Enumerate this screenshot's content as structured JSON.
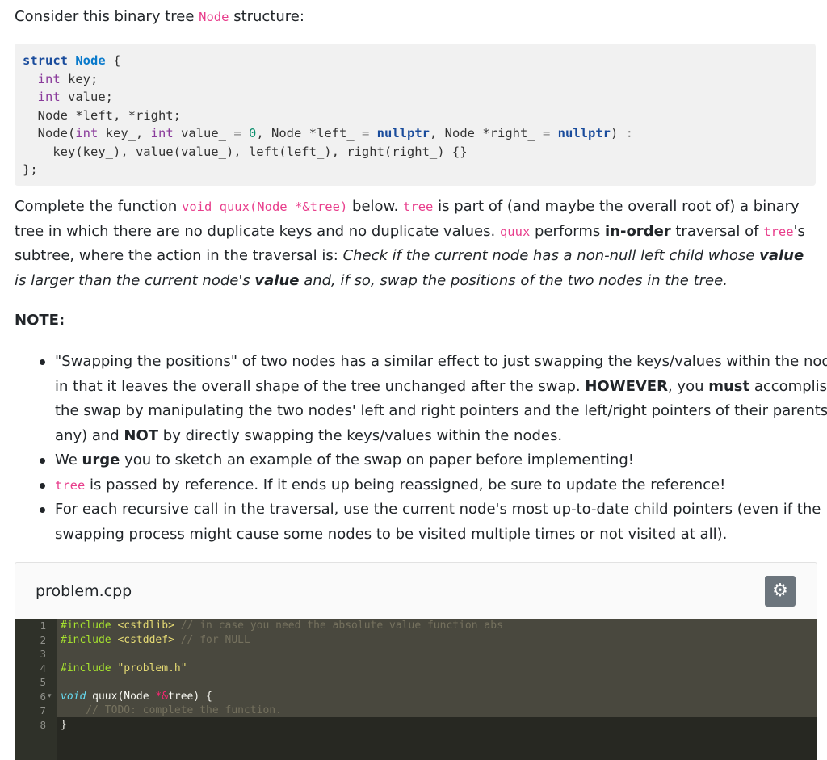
{
  "intro": {
    "before": "Consider this binary tree ",
    "code": "Node",
    "after": " structure:"
  },
  "struct_code": {
    "l1_kw": "struct",
    "l1_name": "Node",
    "l1_rest": " {",
    "l2_type": "int",
    "l2_rest": " key;",
    "l3_type": "int",
    "l3_rest": " value;",
    "l4": "Node *left, *right;",
    "l5_a": "Node(",
    "l5_t1": "int",
    "l5_b": " key_, ",
    "l5_t2": "int",
    "l5_c": " value_ ",
    "l5_eq1": "=",
    "l5_zero": " 0",
    "l5_d": ", Node *left_ ",
    "l5_eq2": "=",
    "l5_null1": " nullptr",
    "l5_e": ", Node *right_ ",
    "l5_eq3": "=",
    "l5_null2": " nullptr",
    "l5_f": ") ",
    "l5_colon": ":",
    "l6": "key(key_), value(value_), left(left_), right(right_) {}",
    "l7": "};"
  },
  "description": {
    "p1": "Complete the function ",
    "c1": "void quux(Node *&tree)",
    "p2": " below. ",
    "c2": "tree",
    "p3": " is part of (and maybe the overall root of) a binary tree in which there are no duplicate keys and no duplicate values. ",
    "c3": "quux",
    "p4": " performs ",
    "b1": "in-order",
    "p5": " traversal of ",
    "c4": "tree",
    "p6": "'s subtree, where the action in the traversal is: ",
    "i1": "Check if the current node has a non-null left child whose ",
    "ib1": "value",
    "i2": " is larger than the current node's ",
    "ib2": "value",
    "i3": " and, if so, swap the positions of the two nodes in the tree."
  },
  "note_heading": "NOTE:",
  "notes": {
    "n1_a": "\"Swapping the positions\" of two nodes has a similar effect to just swapping the keys/values within the nodes, in that it leaves the overall shape of the tree unchanged after the swap. ",
    "n1_b1": "HOWEVER",
    "n1_b": ", you ",
    "n1_b2": "must",
    "n1_c": " accomplish the swap by manipulating the two nodes' left and right pointers and the left/right pointers of their parents (if any) and ",
    "n1_b3": "NOT",
    "n1_d": " by directly swapping the keys/values within the nodes.",
    "n2_a": "We ",
    "n2_b": "urge",
    "n2_c": " you to sketch an example of the swap on paper before implementing!",
    "n3_code": "tree",
    "n3_text": " is passed by reference. If it ends up being reassigned, be sure to update the reference!",
    "n4": "For each recursive call in the traversal, use the current node's most up-to-date child pointers (even if the swapping process might cause some nodes to be visited multiple times or not visited at all)."
  },
  "editor": {
    "file_name": "problem.cpp",
    "settings_icon": "gear-icon",
    "line_numbers": [
      "1",
      "2",
      "3",
      "4",
      "5",
      "6",
      "7",
      "8"
    ],
    "l1_pp": "#include",
    "l1_hdr": " <cstdlib>",
    "l1_cm": " // in case you need the absolute value function abs",
    "l2_pp": "#include",
    "l2_hdr": " <cstddef>",
    "l2_cm": " // for NULL",
    "l4_pp": "#include",
    "l4_str": " \"problem.h\"",
    "l6_type": "void",
    "l6_a": " quux(Node ",
    "l6_op": "*&",
    "l6_b": "tree) {",
    "l7_cm": "    // TODO: complete the function.",
    "l8": "}"
  },
  "colors": {
    "inline_code": "#e83e8c",
    "editor_bg": "#272822",
    "settings_button": "#6c757d"
  }
}
